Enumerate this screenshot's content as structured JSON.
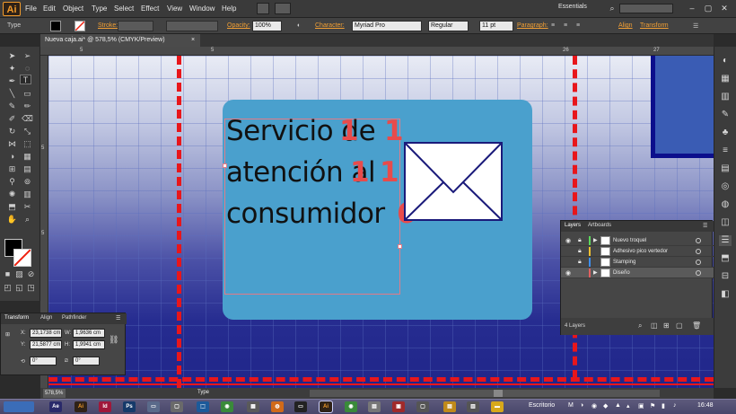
{
  "app": {
    "logo": "Ai",
    "workspace": "Essentials"
  },
  "menu": [
    "File",
    "Edit",
    "Object",
    "Type",
    "Select",
    "Effect",
    "View",
    "Window",
    "Help"
  ],
  "control_bar": {
    "tool_name": "Type",
    "stroke_label": "Stroke:",
    "opacity_label": "Opacity:",
    "opacity_value": "100%",
    "character_label": "Character:",
    "font_family": "Myriad Pro",
    "font_style": "Regular",
    "font_size": "11 pt",
    "paragraph_label": "Paragraph:",
    "align_label": "Align",
    "transform_label": "Transform"
  },
  "document_tab": {
    "title": "Nueva caja.ai* @ 578,5% (CMYK/Preview)",
    "close": "×"
  },
  "ruler": {
    "h_ticks": [
      "5",
      "",
      "5",
      "",
      "",
      "",
      "",
      "",
      "",
      "",
      "",
      "26",
      "",
      "27"
    ],
    "v_ticks": [
      "5",
      "",
      "",
      "",
      "5"
    ]
  },
  "artwork": {
    "lines": [
      "Servicio de",
      "atención al",
      "consumidor"
    ],
    "red_marks": [
      "1",
      "1",
      "1",
      "1",
      "6"
    ],
    "colors": {
      "card": "#4aa0cd",
      "dieline": "#e8161b",
      "envelope_stroke": "#1a1a7a"
    }
  },
  "layers_panel": {
    "tabs": [
      "Layers",
      "Artboards"
    ],
    "layers": [
      {
        "name": "Nuevo troquel",
        "color": "#5cd65c",
        "locked": true,
        "visible": true,
        "selected": false
      },
      {
        "name": "Adhesivo pico vertedor",
        "color": "#f0c030",
        "locked": true,
        "visible": false,
        "selected": false
      },
      {
        "name": "Stamping",
        "color": "#3d8ff0",
        "locked": true,
        "visible": false,
        "selected": false
      },
      {
        "name": "Diseño",
        "color": "#e06060",
        "locked": false,
        "visible": true,
        "selected": true
      }
    ],
    "count": "4 Layers"
  },
  "transform_panel": {
    "tabs": [
      "Transform",
      "Align",
      "Pathfinder"
    ],
    "x_label": "X:",
    "x": "23,1738 cm",
    "y_label": "Y:",
    "y": "21,5877 cm",
    "w_label": "W:",
    "w": "1,9636 cm",
    "h_label": "H:",
    "h": "1,9941 cm",
    "rotate": "0°",
    "shear": "0°"
  },
  "status_bar": {
    "zoom": "578,5%",
    "tool": "Type"
  },
  "taskbar": {
    "language": "Escritorio",
    "clock": "16:48"
  }
}
